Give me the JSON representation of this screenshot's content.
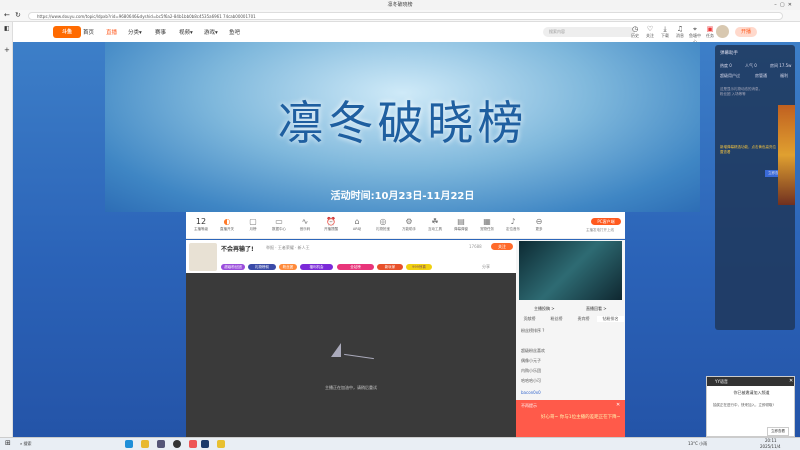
{
  "browser": {
    "title": "凛冬破晓榜",
    "url": "https://www.douyu.com/topic/ldpxb?rid=9680646&dyshid=bc5f6a2-84b1bb0b8c4535a6961 74cab00001701"
  },
  "nav": {
    "logo": "斗鱼",
    "items": [
      "首页",
      "直播",
      "分类▾",
      "赛事",
      "视频▾",
      "游戏▾",
      "鱼吧"
    ],
    "search_placeholder": "搜索内容",
    "icons": [
      {
        "name": "history",
        "label": "历史"
      },
      {
        "name": "follow",
        "label": "关注"
      },
      {
        "name": "download",
        "label": "下载"
      },
      {
        "name": "message",
        "label": "消息"
      },
      {
        "name": "dungeon",
        "label": "鱼塘中心"
      },
      {
        "name": "task",
        "label": "任务"
      }
    ],
    "live_btn": "开播"
  },
  "banner": {
    "title": "凛冬破晓榜",
    "date": "活动时间:10月23日-11月22日"
  },
  "toolbar": {
    "level": "12",
    "level_label": "主播等级",
    "items": [
      "直播开关",
      "月榜",
      "数据中心",
      "音乐码",
      "开播提醒",
      "AR动",
      "礼物抢宝",
      "万能助手",
      "互动工具",
      "弹幕弹窗",
      "宠物任务",
      "定位音乐",
      "更多"
    ],
    "pc_btn": "PC客户端",
    "pc_sub": "主播发电打开上线"
  },
  "streamer": {
    "name": "不会再输了!",
    "sub": "举报 · 王者荣耀 · 新人王",
    "follow": "关注",
    "fans": "17688",
    "share": "分享"
  },
  "badges": [
    "超级粉丝团",
    "礼物榜前",
    "粉丝团",
    "福利机会",
    "全站榜",
    "新玩家",
    "999惊喜"
  ],
  "video": {
    "status": "主播正在加油中，请稍后重试"
  },
  "side": {
    "tabs": [
      "贡献榜",
      "粉丝榜",
      "贵宾榜",
      "钻粉排名"
    ],
    "links": [
      "主播投稿 >",
      "直播回看 >"
    ],
    "note": "粉丝榜排序 ?",
    "ranks": [
      "超级粉丝喜欢",
      "偶像小元子",
      "内购小乐团",
      "哈哈哈小可"
    ],
    "user": "bacon0x0",
    "red_title": "不再提示",
    "red_text": "好心哥~ 你与1位主播的差距正在下降~"
  },
  "assistant": {
    "title": "弹幕助手",
    "stats": [
      "热度 0",
      "人气 0",
      "房间 17.5w"
    ],
    "tabs": [
      "超级用户过",
      "房管通",
      "福利"
    ],
    "text1": "这是显示礼物动态的消息，粉丝团 入场等等",
    "text2": "新增弹幕精选功能，点击黄色高亮位置查看",
    "btn": "立即查看"
  },
  "notif": {
    "app": "YY语音",
    "title": "你已被邀请加入频道",
    "body": "抽奖正在进行中，快来加入，立即领取!",
    "btn": "立即查看"
  },
  "taskbar": {
    "search": "搜索",
    "weather": "13°C 小雨",
    "time": "20:11",
    "date": "2025/11/4"
  }
}
